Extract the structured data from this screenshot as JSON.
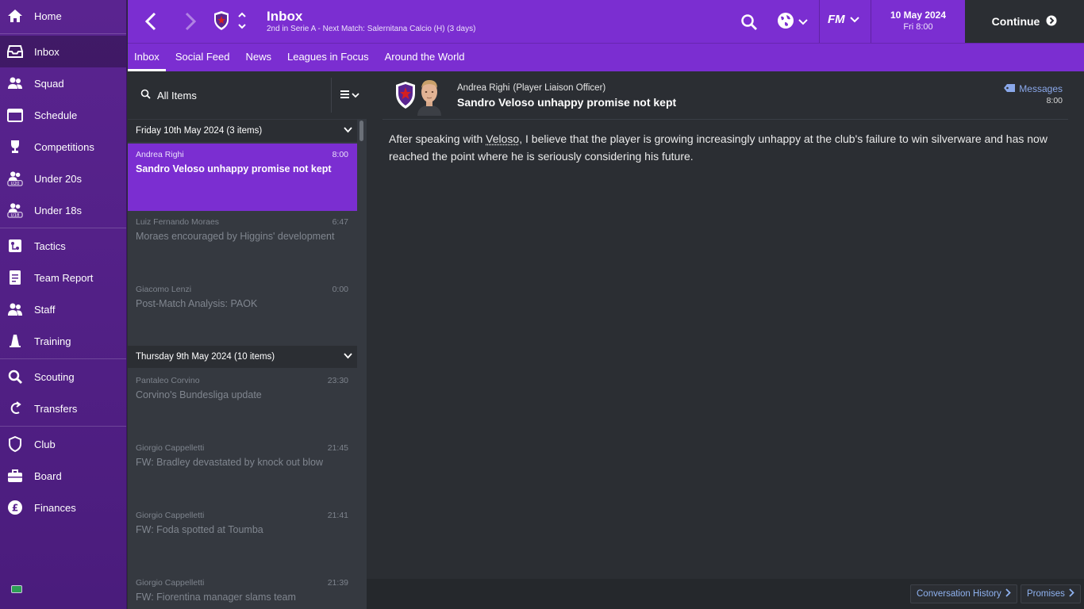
{
  "sidebar": {
    "items": [
      {
        "label": "Home",
        "icon": "home-icon",
        "active": false
      },
      {
        "label": "Inbox",
        "icon": "inbox-icon",
        "active": true
      },
      {
        "label": "Squad",
        "icon": "squad-icon",
        "active": false
      },
      {
        "label": "Schedule",
        "icon": "schedule-icon",
        "active": false
      },
      {
        "label": "Competitions",
        "icon": "trophy-icon",
        "active": false
      },
      {
        "label": "Under 20s",
        "icon": "u20-icon",
        "active": false
      },
      {
        "label": "Under 18s",
        "icon": "u18-icon",
        "active": false
      },
      {
        "label": "Tactics",
        "icon": "tactics-icon",
        "active": false
      },
      {
        "label": "Team Report",
        "icon": "report-icon",
        "active": false
      },
      {
        "label": "Staff",
        "icon": "staff-icon",
        "active": false
      },
      {
        "label": "Training",
        "icon": "training-icon",
        "active": false
      },
      {
        "label": "Scouting",
        "icon": "scouting-icon",
        "active": false
      },
      {
        "label": "Transfers",
        "icon": "transfers-icon",
        "active": false
      },
      {
        "label": "Club",
        "icon": "club-icon",
        "active": false
      },
      {
        "label": "Board",
        "icon": "board-icon",
        "active": false
      },
      {
        "label": "Finances",
        "icon": "finances-icon",
        "active": false
      }
    ],
    "badges": {
      "u20": "U20",
      "u18": "U18"
    }
  },
  "header": {
    "title": "Inbox",
    "subtitle": "2nd in Serie A - Next Match: Salernitana Calcio (H) (3 days)",
    "fm_label": "FM",
    "date": "10 May 2024",
    "day_time": "Fri 8:00",
    "continue_label": "Continue"
  },
  "tabs": [
    {
      "label": "Inbox",
      "active": true
    },
    {
      "label": "Social Feed",
      "active": false
    },
    {
      "label": "News",
      "active": false
    },
    {
      "label": "Leagues in Focus",
      "active": false
    },
    {
      "label": "Around the World",
      "active": false
    }
  ],
  "list": {
    "filter_label": "All Items",
    "groups": [
      {
        "label": "Friday 10th May 2024 (3 items)"
      },
      {
        "label": "Thursday 9th May 2024 (10 items)"
      }
    ],
    "messages": [
      {
        "from": "Andrea Righi",
        "subject": "Sandro Veloso unhappy promise not kept",
        "time": "8:00",
        "selected": true
      },
      {
        "from": "Luiz Fernando Moraes",
        "subject": "Moraes encouraged by Higgins' development",
        "time": "6:47",
        "selected": false
      },
      {
        "from": "Giacomo Lenzi",
        "subject": "Post-Match Analysis: PAOK",
        "time": "0:00",
        "selected": false
      },
      {
        "from": "Pantaleo Corvino",
        "subject": "Corvino's Bundesliga update",
        "time": "23:30",
        "selected": false
      },
      {
        "from": "Giorgio Cappelletti",
        "subject": "FW: Bradley devastated by knock out blow",
        "time": "21:45",
        "selected": false
      },
      {
        "from": "Giorgio Cappelletti",
        "subject": "FW: Foda spotted at Toumba",
        "time": "21:41",
        "selected": false
      },
      {
        "from": "Giorgio Cappelletti",
        "subject": "FW: Fiorentina manager slams team",
        "time": "21:39",
        "selected": false
      }
    ]
  },
  "message": {
    "sender": "Andrea Righi",
    "role": "(Player Liaison Officer)",
    "subject": "Sandro Veloso unhappy promise not kept",
    "messages_link": "Messages",
    "time": "8:00",
    "body_pre": "After speaking with ",
    "body_name": "Veloso",
    "body_post": ", I believe that the player is growing increasingly unhappy at the club's failure to win silverware and has now reached the point where he is seriously considering his future.",
    "footer_buttons": [
      "Conversation History",
      "Promises"
    ]
  },
  "colors": {
    "accent": "#7b2ed1",
    "sidebar": "#5a2490",
    "panel": "#2b2e33",
    "link": "#8fb2f0"
  }
}
